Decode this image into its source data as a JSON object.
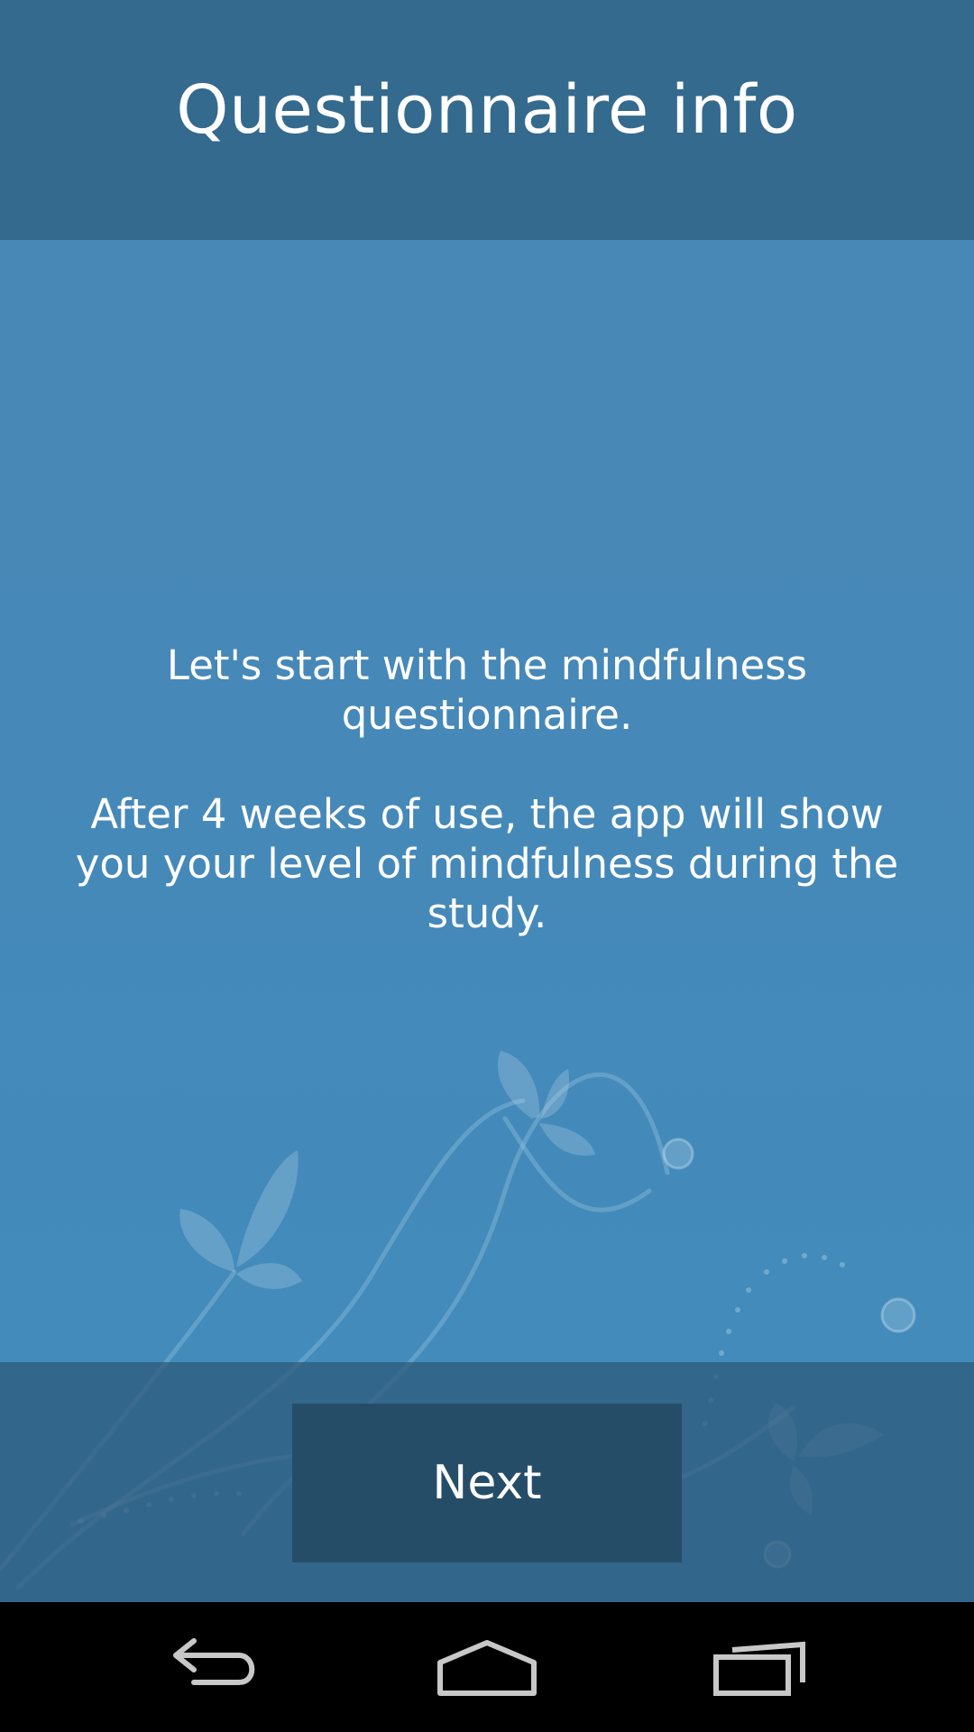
{
  "header": {
    "title": "Questionnaire info"
  },
  "content": {
    "paragraph_1": "Let's start with the mindfulness questionnaire.",
    "paragraph_2": "After 4 weeks of use, the app will show you your level of mindfulness during the study."
  },
  "footer": {
    "next_label": "Next"
  },
  "navbar": {
    "back_icon": "back-icon",
    "home_icon": "home-icon",
    "recent_icon": "recent-apps-icon"
  },
  "colors": {
    "header": "#346a8d",
    "background": "#4589b9",
    "button": "#264d68",
    "navbar": "#000000",
    "text": "#ffffff"
  }
}
